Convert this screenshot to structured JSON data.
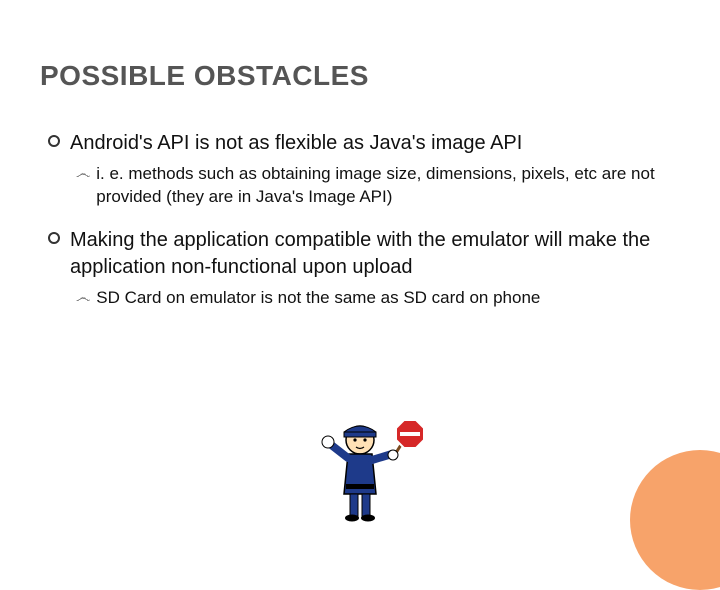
{
  "title": "POSSIBLE OBSTACLES",
  "items": [
    {
      "text": "Android's API is not as flexible as Java's image API",
      "sub": [
        {
          "text": "i. e. methods such as obtaining image size, dimensions, pixels, etc are not provided (they are in Java's Image API)"
        }
      ]
    },
    {
      "text": "Making the application compatible with the emulator will make the application non-functional upon upload",
      "sub": [
        {
          "text": "SD Card on emulator is not the same as SD card on phone"
        }
      ]
    }
  ]
}
